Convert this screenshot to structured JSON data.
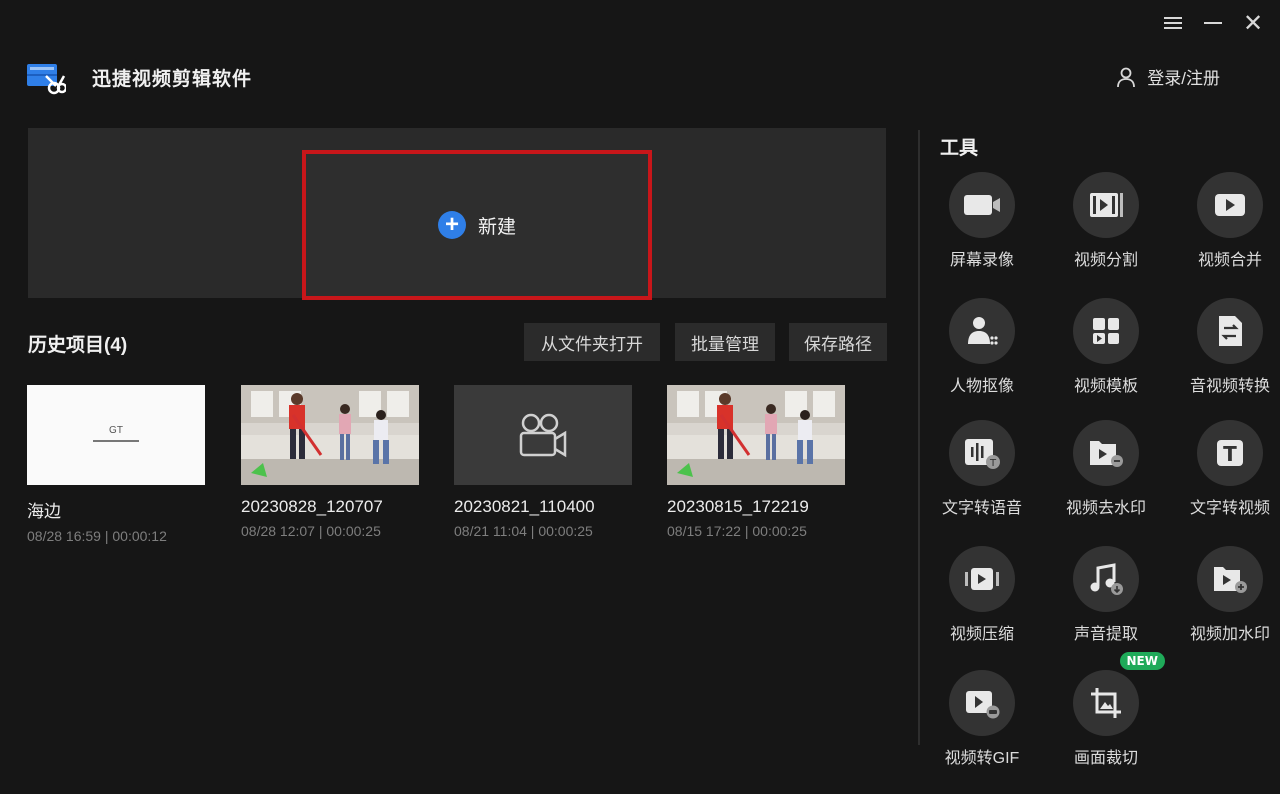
{
  "header": {
    "app_title": "迅捷视频剪辑软件",
    "login_label": "登录/注册"
  },
  "new_project": {
    "label": "新建"
  },
  "history": {
    "title": "历史项目(4)",
    "buttons": {
      "open_folder": "从文件夹打开",
      "batch_manage": "批量管理",
      "save_path": "保存路径"
    },
    "items": [
      {
        "name": "海边",
        "meta": "08/28 16:59 | 00:00:12",
        "thumb_text": "GT"
      },
      {
        "name": "20230828_120707",
        "meta": "08/28 12:07 | 00:00:25"
      },
      {
        "name": "20230821_110400",
        "meta": "08/21 11:04 | 00:00:25"
      },
      {
        "name": "20230815_172219",
        "meta": "08/15 17:22 | 00:00:25"
      }
    ]
  },
  "tools": {
    "title": "工具",
    "items": [
      {
        "label": "屏幕录像",
        "icon": "screen-record-icon"
      },
      {
        "label": "视频分割",
        "icon": "video-split-icon"
      },
      {
        "label": "视频合并",
        "icon": "video-merge-icon"
      },
      {
        "label": "人物抠像",
        "icon": "portrait-cutout-icon"
      },
      {
        "label": "视频模板",
        "icon": "video-template-icon"
      },
      {
        "label": "音视频转换",
        "icon": "av-convert-icon"
      },
      {
        "label": "文字转语音",
        "icon": "text-to-speech-icon"
      },
      {
        "label": "视频去水印",
        "icon": "remove-watermark-icon"
      },
      {
        "label": "文字转视频",
        "icon": "text-to-video-icon"
      },
      {
        "label": "视频压缩",
        "icon": "video-compress-icon"
      },
      {
        "label": "声音提取",
        "icon": "audio-extract-icon"
      },
      {
        "label": "视频加水印",
        "icon": "add-watermark-icon"
      },
      {
        "label": "视频转GIF",
        "icon": "video-to-gif-icon"
      },
      {
        "label": "画面裁切",
        "icon": "crop-icon",
        "badge": "NEW"
      }
    ]
  },
  "colors": {
    "accent_blue": "#2f7fe8",
    "highlight_red": "#c8161a",
    "badge_green": "#1faa59"
  }
}
